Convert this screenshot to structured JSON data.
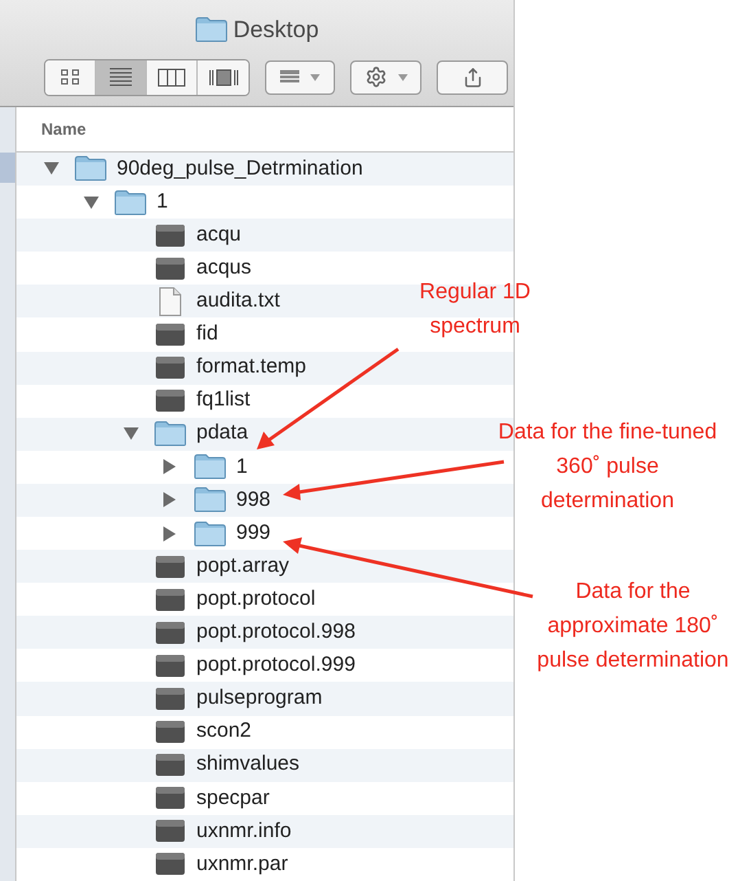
{
  "window": {
    "title": "Desktop"
  },
  "toolbar": {
    "view_buttons": [
      {
        "kind": "icons",
        "selected": false
      },
      {
        "kind": "list",
        "selected": true
      },
      {
        "kind": "columns",
        "selected": false
      },
      {
        "kind": "coverflow",
        "selected": false
      }
    ]
  },
  "column_header": "Name",
  "tree": [
    {
      "name": "90deg_pulse_Detrmination",
      "kind": "folder",
      "expanded": true,
      "children": [
        {
          "name": "1",
          "kind": "folder",
          "expanded": true,
          "children": [
            {
              "name": "acqu",
              "kind": "file"
            },
            {
              "name": "acqus",
              "kind": "file"
            },
            {
              "name": "audita.txt",
              "kind": "text"
            },
            {
              "name": "fid",
              "kind": "file"
            },
            {
              "name": "format.temp",
              "kind": "file"
            },
            {
              "name": "fq1list",
              "kind": "file"
            },
            {
              "name": "pdata",
              "kind": "folder",
              "expanded": true,
              "children": [
                {
                  "name": "1",
                  "kind": "folder",
                  "expanded": false
                },
                {
                  "name": "998",
                  "kind": "folder",
                  "expanded": false
                },
                {
                  "name": "999",
                  "kind": "folder",
                  "expanded": false
                }
              ]
            },
            {
              "name": "popt.array",
              "kind": "file"
            },
            {
              "name": "popt.protocol",
              "kind": "file"
            },
            {
              "name": "popt.protocol.998",
              "kind": "file"
            },
            {
              "name": "popt.protocol.999",
              "kind": "file"
            },
            {
              "name": "pulseprogram",
              "kind": "file"
            },
            {
              "name": "scon2",
              "kind": "file"
            },
            {
              "name": "shimvalues",
              "kind": "file"
            },
            {
              "name": "specpar",
              "kind": "file"
            },
            {
              "name": "uxnmr.info",
              "kind": "file"
            },
            {
              "name": "uxnmr.par",
              "kind": "file"
            }
          ]
        }
      ]
    }
  ],
  "annotations": [
    {
      "text": "Regular 1D\nspectrum"
    },
    {
      "text": "Data for the fine-tuned\n360˚ pulse\ndetermination"
    },
    {
      "text": "Data for the\napproximate 180˚\npulse determination"
    }
  ]
}
